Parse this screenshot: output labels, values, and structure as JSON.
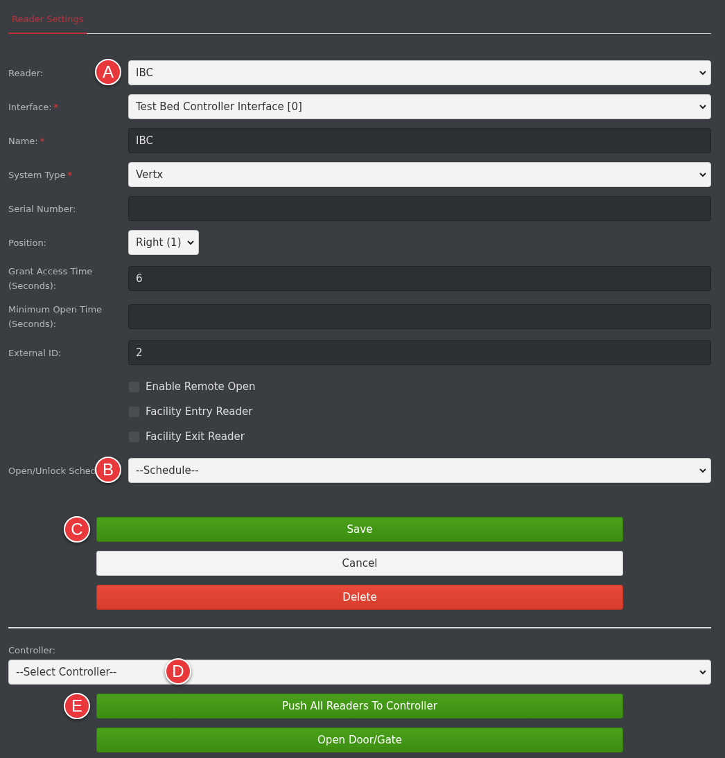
{
  "tabs": [
    {
      "label": "Reader Settings",
      "selected": true
    }
  ],
  "fields": [
    {
      "label": "Reader:",
      "kind": "select",
      "value": "IBC",
      "badge": "A"
    },
    {
      "label": "Interface:",
      "marker": "*",
      "kind": "select",
      "value": "Test Bed Controller Interface [0]"
    },
    {
      "label": "Name:",
      "marker": "*",
      "kind": "input",
      "value": "IBC"
    },
    {
      "label": "System Type",
      "marker": "*",
      "kind": "select",
      "value": "Vertx"
    },
    {
      "label": "Serial Number:",
      "kind": "input"
    },
    {
      "label": "Position:",
      "kind": "small-select",
      "value": "Right (1)"
    },
    {
      "label": "Grant Access Time (Seconds):",
      "kind": "input",
      "value": "6"
    },
    {
      "label": "Minimum Open Time (Seconds):",
      "kind": "input"
    },
    {
      "label": "External ID:",
      "kind": "input",
      "value": "2"
    },
    {
      "label": "Enable Remote Open",
      "kind": "checkbox",
      "checked": false
    },
    {
      "label": "Facility Entry Reader",
      "kind": "checkbox",
      "checked": false
    },
    {
      "label": "Facility Exit Reader",
      "kind": "checkbox",
      "checked": false
    },
    {
      "label": "Open/Unlock Sched",
      "kind": "select",
      "value": "--Schedule--",
      "badge": "B"
    }
  ],
  "buttons": [
    {
      "label": "Save",
      "kind": "success",
      "badge": "C"
    },
    {
      "label": "Cancel",
      "kind": "light"
    },
    {
      "label": "Delete",
      "kind": "danger"
    }
  ],
  "controller": {
    "label": "Controller:",
    "value": "--Select Controller--",
    "badge": "D"
  },
  "controller_buttons": [
    {
      "label": "Push All Readers To Controller",
      "kind": "success",
      "badge": "E"
    },
    {
      "label": "Open Door/Gate",
      "kind": "success"
    }
  ]
}
